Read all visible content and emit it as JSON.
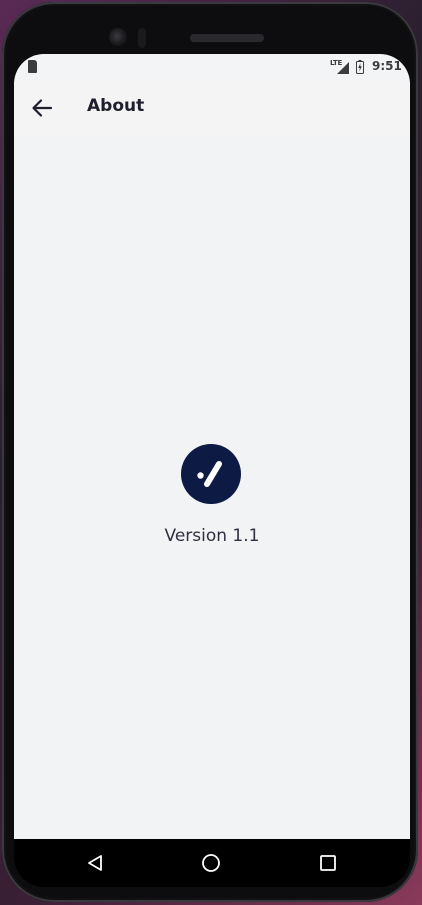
{
  "status_bar": {
    "network": "LTE",
    "time": "9:51"
  },
  "app_bar": {
    "title": "About",
    "back_icon": "arrow-left-icon"
  },
  "content": {
    "logo_icon": "check-logo-icon",
    "version": "Version 1.1"
  },
  "nav_bar": {
    "back_icon": "triangle-back-icon",
    "home_icon": "circle-home-icon",
    "recents_icon": "square-recents-icon"
  },
  "colors": {
    "logo_bg": "#0c1a44",
    "screen_bg": "#f2f3f5",
    "app_bar_bg": "#f4f4f5",
    "title_text": "#1e1e2c"
  }
}
